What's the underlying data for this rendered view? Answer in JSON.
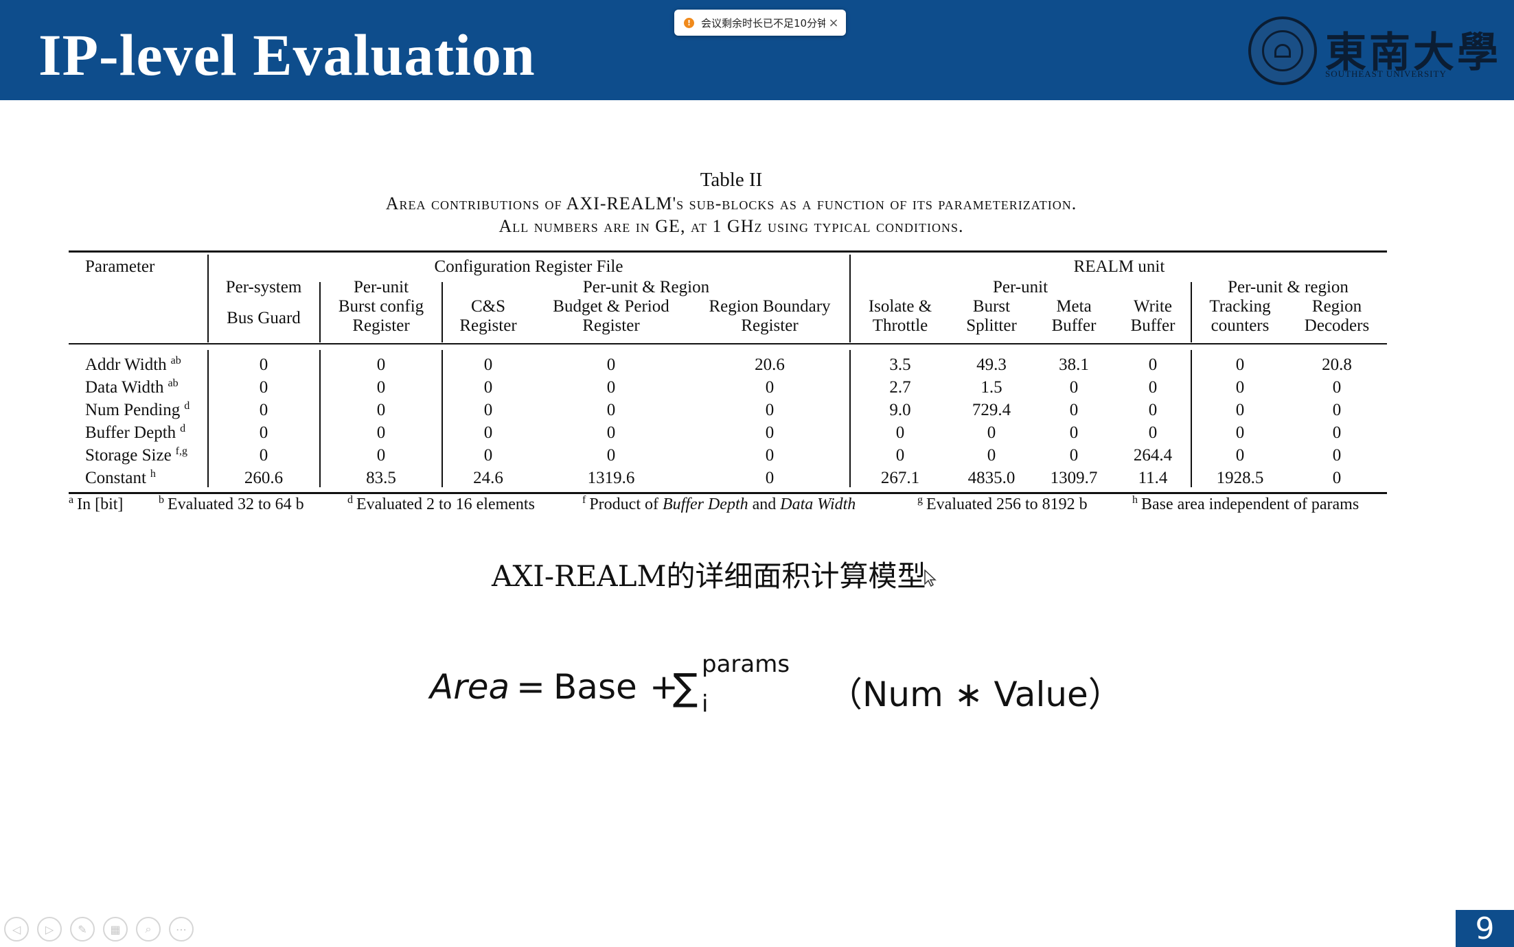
{
  "slide": {
    "title": "IP-level Evaluation",
    "page_number": "9"
  },
  "logo": {
    "cn": "東南大學",
    "en": "SOUTHEAST UNIVERSITY"
  },
  "toast": {
    "icon": "!",
    "text": "会议剩余时长已不足10分钟。",
    "close": "×"
  },
  "table": {
    "label": "Table II",
    "caption_line1": "Area contributions of AXI-REALM's sub-blocks as a function of its parameterization.",
    "caption_line2": "All numbers are in GE, at 1 GHz using typical conditions.",
    "headers": {
      "parameter": "Parameter",
      "config_group": "Configuration Register File",
      "realm_group": "REALM unit",
      "per_system": "Per-system",
      "bus_guard": "Bus Guard",
      "per_unit_1": "Per-unit",
      "burst_config_1": "Burst config",
      "burst_config_2": "Register",
      "cs_1": "C&S",
      "cs_2": "Register",
      "per_unit_region": "Per-unit & Region",
      "budget_1": "Budget & Period",
      "budget_2": "Register",
      "boundary_1": "Region Boundary",
      "boundary_2": "Register",
      "isolate_1": "Isolate &",
      "isolate_2": "Throttle",
      "per_unit_2": "Per-unit",
      "burst_1": "Burst",
      "burst_2": "Splitter",
      "meta_1": "Meta",
      "meta_2": "Buffer",
      "write_1": "Write",
      "write_2": "Buffer",
      "per_unit_region_2": "Per-unit & region",
      "tracking_1": "Tracking",
      "tracking_2": "counters",
      "region_1": "Region",
      "region_2": "Decoders"
    },
    "rows": [
      {
        "name": "Addr Width",
        "sup": "ab",
        "values": [
          "0",
          "0",
          "0",
          "0",
          "20.6",
          "3.5",
          "49.3",
          "38.1",
          "0",
          "0",
          "20.8"
        ]
      },
      {
        "name": "Data Width",
        "sup": "ab",
        "values": [
          "0",
          "0",
          "0",
          "0",
          "0",
          "2.7",
          "1.5",
          "0",
          "0",
          "0",
          "0"
        ]
      },
      {
        "name": "Num Pending",
        "sup": "d",
        "values": [
          "0",
          "0",
          "0",
          "0",
          "0",
          "9.0",
          "729.4",
          "0",
          "0",
          "0",
          "0"
        ]
      },
      {
        "name": "Buffer Depth",
        "sup": "d",
        "values": [
          "0",
          "0",
          "0",
          "0",
          "0",
          "0",
          "0",
          "0",
          "0",
          "0",
          "0"
        ]
      },
      {
        "name": "Storage Size",
        "sup": "f,g",
        "values": [
          "0",
          "0",
          "0",
          "0",
          "0",
          "0",
          "0",
          "0",
          "264.4",
          "0",
          "0"
        ]
      },
      {
        "name": "Constant",
        "sup": "h",
        "values": [
          "260.6",
          "83.5",
          "24.6",
          "1319.6",
          "0",
          "267.1",
          "4835.0",
          "1309.7",
          "11.4",
          "1928.5",
          "0"
        ]
      }
    ],
    "footnotes": {
      "a_mark": "a",
      "a_text": "In [bit]",
      "b_mark": "b",
      "b_text": "Evaluated 32 to 64 b",
      "d_mark": "d",
      "d_text": "Evaluated 2 to 16 elements",
      "f_mark": "f",
      "f_text_1": "Product of ",
      "f_text_2": "Buffer Depth",
      "f_text_3": " and ",
      "f_text_4": "Data Width",
      "g_mark": "g",
      "g_text": "Evaluated 256 to 8192 b",
      "h_mark": "h",
      "h_text": "Base area independent of params"
    }
  },
  "subtitle": "AXI-REALM的详细面积计算模型",
  "formula": {
    "area": "Area",
    "eq": "=",
    "base": "Base",
    "plus": "+",
    "sigma": "∑",
    "sub": "i",
    "sup": "params",
    "body": "（Num ∗ Value）"
  },
  "controls": {
    "prev": "◁",
    "next": "▷",
    "pen": "✎",
    "slides": "▦",
    "zoom": "⌕",
    "more": "⋯"
  }
}
